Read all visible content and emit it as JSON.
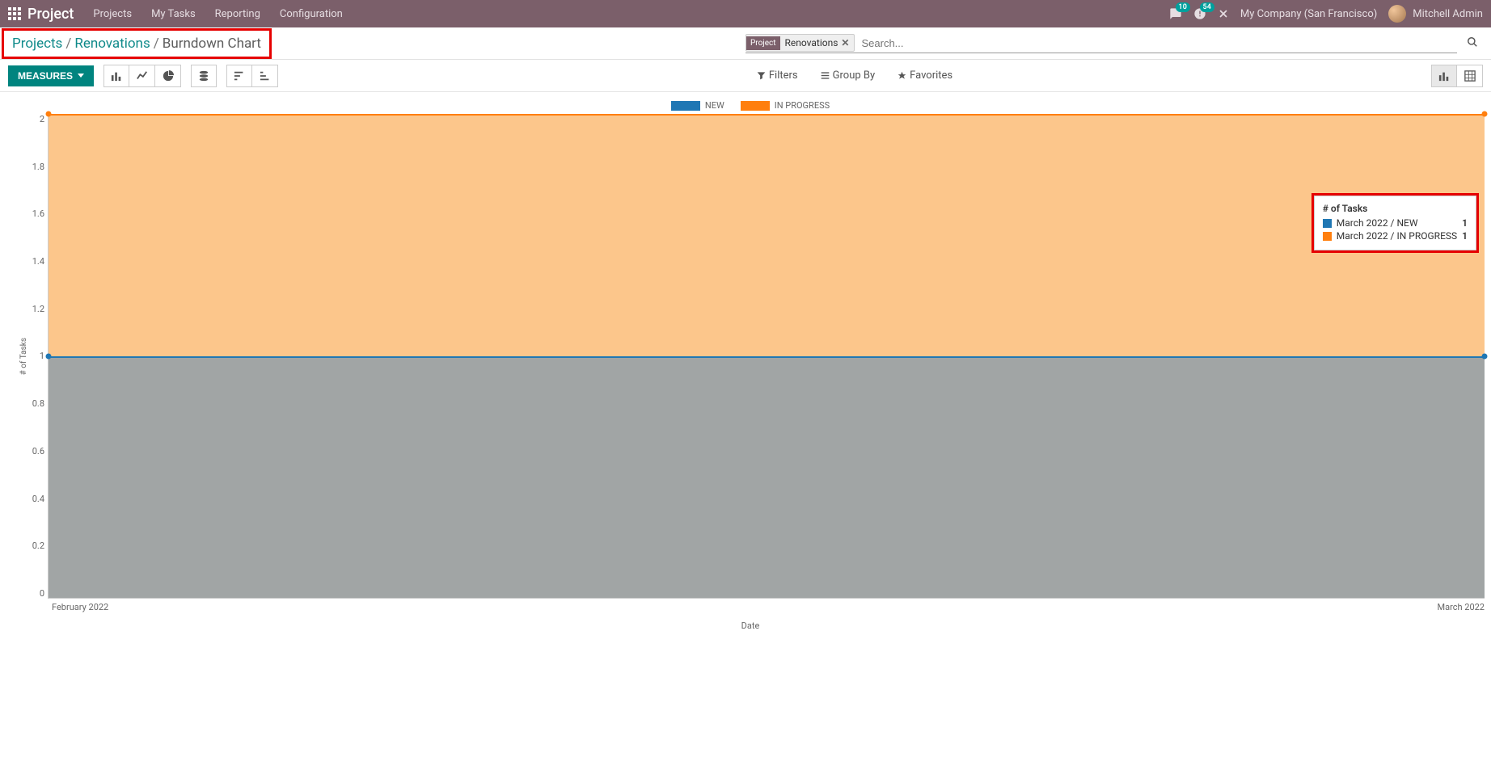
{
  "nav": {
    "brand": "Project",
    "menu": [
      "Projects",
      "My Tasks",
      "Reporting",
      "Configuration"
    ],
    "messages_badge": "10",
    "activities_badge": "54",
    "company": "My Company (San Francisco)",
    "user": "Mitchell Admin"
  },
  "breadcrumb": {
    "items": [
      "Projects",
      "Renovations",
      "Burndown Chart"
    ]
  },
  "search": {
    "pill_category": "Project",
    "pill_value": "Renovations",
    "placeholder": "Search..."
  },
  "toolbar": {
    "measures_label": "MEASURES",
    "filters_label": "Filters",
    "groupby_label": "Group By",
    "favorites_label": "Favorites"
  },
  "chart_data": {
    "type": "area",
    "title": "",
    "xlabel": "Date",
    "ylabel": "# of Tasks",
    "ylim": [
      0,
      2
    ],
    "yticks": [
      "2",
      "1.8",
      "1.6",
      "1.4",
      "1.2",
      "1",
      "0.8",
      "0.6",
      "0.4",
      "0.2",
      "0"
    ],
    "x": [
      "February 2022",
      "March 2022"
    ],
    "series": [
      {
        "name": "NEW",
        "values": [
          1,
          1
        ],
        "color": "#1f77b4"
      },
      {
        "name": "IN PROGRESS",
        "values": [
          1,
          1
        ],
        "color": "#ff7f0e"
      }
    ],
    "stacked_totals": [
      2,
      2
    ],
    "tooltip": {
      "title": "# of Tasks",
      "rows": [
        {
          "label": "March 2022 / NEW",
          "value": "1",
          "color": "#1f77b4"
        },
        {
          "label": "March 2022 / IN PROGRESS",
          "value": "1",
          "color": "#ff7f0e"
        }
      ]
    }
  }
}
